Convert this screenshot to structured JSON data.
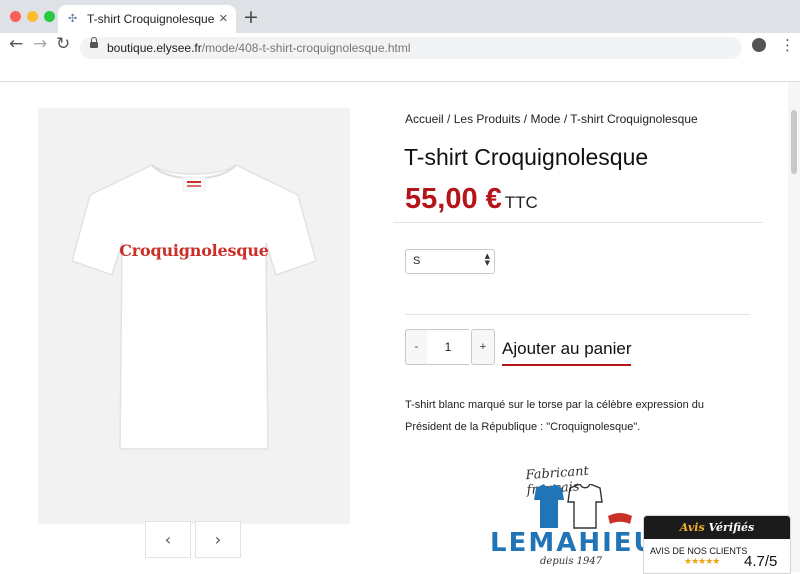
{
  "browser": {
    "tab_title": "T-shirt Croquignolesque",
    "new_tab_label": "+",
    "url_host": "boutique.elysee.fr",
    "url_path": "/mode/408-t-shirt-croquignolesque.html"
  },
  "breadcrumb": [
    {
      "label": "Accueil"
    },
    {
      "label": "Les Produits"
    },
    {
      "label": "Mode"
    },
    {
      "label": "T-shirt Croquignolesque"
    }
  ],
  "breadcrumb_separator": "/",
  "product": {
    "title": "T-shirt Croquignolesque",
    "price": "55,00 €",
    "price_suffix": "TTC",
    "image_slogan": "Croquignolesque",
    "image_tag": "ELYSEE"
  },
  "size_select": {
    "selected": "S"
  },
  "quantity": {
    "decrement_label": "-",
    "value": "1",
    "increment_label": "+"
  },
  "add_to_cart_label": "Ajouter au panier",
  "description": [
    "T-shirt blanc marqué sur le torse par la célèbre expression du",
    "Président de la République : \"Croquignolesque\"."
  ],
  "maker_logo": {
    "top_text": "Fabricant français",
    "brand": "LEMAHIEU",
    "since": "depuis 1947"
  },
  "reviews": {
    "header_part1": "Avis",
    "header_part2": "Vérifiés",
    "label": "AVIS DE NOS CLIENTS",
    "stars": "★★★★★",
    "score": "4.7/5"
  },
  "icons": {
    "prev": "‹",
    "next": "›",
    "back": "←",
    "forward": "→",
    "reload": "↻",
    "star": "☆",
    "menu": "⋮",
    "close": "✕",
    "select_caret_up": "▲",
    "select_caret_down": "▼"
  },
  "colors": {
    "price_red": "#b3151b",
    "slogan_red": "#c93028",
    "brand_blue": "#2174b5",
    "review_gold": "#f0b22a"
  }
}
